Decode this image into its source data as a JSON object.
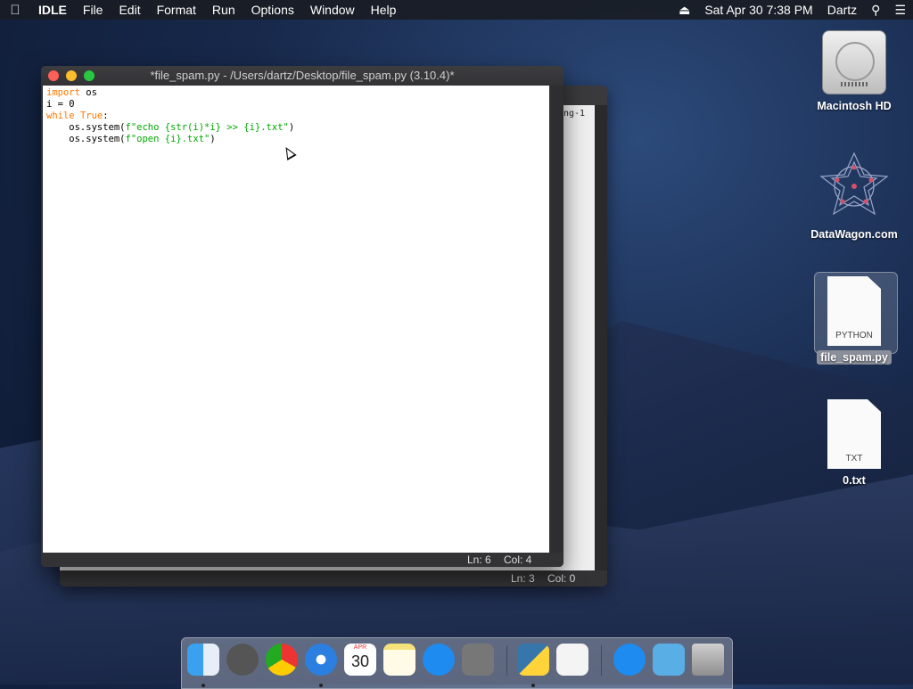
{
  "menubar": {
    "app": "IDLE",
    "items": [
      "File",
      "Edit",
      "Format",
      "Run",
      "Options",
      "Window",
      "Help"
    ],
    "datetime": "Sat Apr 30  7:38 PM",
    "user": "Dartz"
  },
  "front_window": {
    "title": "*file_spam.py - /Users/dartz/Desktop/file_spam.py (3.10.4)*",
    "code": {
      "l1_kw": "import",
      "l1_rest": " os",
      "l2": "i = 0",
      "l3_kw1": "while",
      "l3_kw2": "True",
      "l3_rest": ":",
      "l4_a": "    os.system(",
      "l4_str": "f\"echo {str(i)*i} >> {i}.txt\"",
      "l4_b": ")",
      "l5_a": "    os.system(",
      "l5_str": "f\"open {i}.txt\"",
      "l5_b": ")"
    },
    "status_ln": "Ln: 6",
    "status_col": "Col: 4"
  },
  "back_window": {
    "fragment": "ng-1",
    "status_ln": "Ln: 3",
    "status_col": "Col: 0"
  },
  "desktop": {
    "hd_label": "Macintosh HD",
    "dw_label": "DataWagon.com",
    "py_type": "PYTHON",
    "py_label": "file_spam.py",
    "txt_type": "TXT",
    "txt_label": "0.txt"
  },
  "dock": {
    "calendar_month": "APR",
    "calendar_day": "30"
  },
  "colors": {
    "keyword": "#ff7700",
    "string": "#00aa00",
    "close": "#fe5f57",
    "minimize": "#febc2e",
    "zoom": "#28c840"
  }
}
